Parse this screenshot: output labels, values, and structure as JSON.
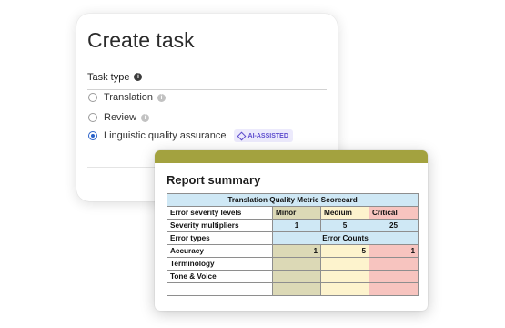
{
  "create_task": {
    "title": "Create task",
    "task_type_label": "Task type",
    "options": [
      {
        "label": "Translation",
        "selected": false,
        "info_icon": true
      },
      {
        "label": "Review",
        "selected": false,
        "info_icon": true
      },
      {
        "label": "Linguistic quality assurance",
        "selected": true,
        "badge": "AI-ASSISTED"
      }
    ]
  },
  "report": {
    "title": "Report summary",
    "scorecard": {
      "title": "Translation Quality Metric Scorecard",
      "severity_label": "Error severity levels",
      "levels": [
        "Minor",
        "Medium",
        "Critical"
      ],
      "multiplier_label": "Severity multipliers",
      "multipliers": [
        "1",
        "5",
        "25"
      ],
      "error_types_label": "Error types",
      "error_counts_label": "Error Counts",
      "rows": [
        {
          "type": "Accuracy",
          "counts": [
            "1",
            "5",
            "1"
          ]
        },
        {
          "type": "Terminology",
          "counts": [
            "",
            "",
            ""
          ]
        },
        {
          "type": "Tone & Voice",
          "counts": [
            "",
            "",
            ""
          ]
        },
        {
          "type": "",
          "counts": [
            "",
            "",
            ""
          ]
        }
      ]
    }
  },
  "colors": {
    "accent_bar": "#a3a23f",
    "selected_radio": "#2a62c9",
    "badge_text": "#5d4ccd",
    "header_blue": "#cfe8f5",
    "minor": "#dcd9b6",
    "medium": "#fdf3cd",
    "critical": "#f7c4bf"
  }
}
